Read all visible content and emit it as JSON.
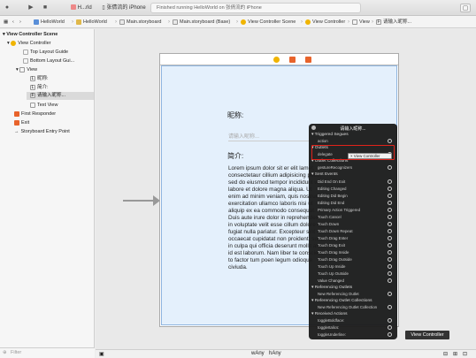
{
  "toolbar": {
    "scheme": "H...rld",
    "device": "张倩流的 iPhone",
    "status": "Finished running HelloWorld on 张倩流的 iPhone"
  },
  "jumpbar": {
    "items": [
      "HelloWorld",
      "HelloWorld",
      "Main.storyboard",
      "Main.storyboard (Base)",
      "View Controller Scene",
      "View Controller",
      "View",
      "请输入昵称..."
    ]
  },
  "outline": {
    "scene": "View Controller Scene",
    "vc": "View Controller",
    "top_guide": "Top Layout Guide",
    "bottom_guide": "Bottom Layout Gui...",
    "view": "View",
    "label_nick": "昵称:",
    "label_intro": "简介:",
    "field": "请输入昵称...",
    "textview": "Text View",
    "first_responder": "First Responder",
    "exit": "Exit",
    "entry": "Storyboard Entry Point",
    "filter_placeholder": "Filter"
  },
  "scene": {
    "nick_label": "昵称:",
    "field_placeholder": "请输入昵称...",
    "intro_label": "简介:",
    "lorem": "Lorem ipsum dolor sit er elit lamet, consectetaur cillium adipisicing pecu, sed do eiusmod tempor incididunt ut labore et dolore magna aliqua. Ut enim ad minim veniam, quis nostrud exercitation ullamco laboris nisi ut aliquip ex ea commodo consequat. Duis aute irure dolor in reprehenderit in voluptate velit esse cillum dolore eu fugiat nulla pariatur. Excepteur sint occaecat cupidatat non proident, sunt in culpa qui officia deserunt mollit anim id est laborum. Nam liber te conscient to factor tum poen legum odioque civiuda."
  },
  "hud": {
    "title": "请输入昵称...",
    "triggered_segues": "Triggered Segues",
    "action": "action",
    "outlets": "Outlets",
    "delegate": "delegate",
    "delegate_target": "View Controller",
    "outlet_collections": "Outlet Collections",
    "gesture_recognizers": "gestureRecognizers",
    "sent_events": "Sent Events",
    "events": [
      "Did End On Exit",
      "Editing Changed",
      "Editing Did Begin",
      "Editing Did End",
      "Primary Action Triggered",
      "Touch Cancel",
      "Touch Down",
      "Touch Down Repeat",
      "Touch Drag Enter",
      "Touch Drag Exit",
      "Touch Drag Inside",
      "Touch Drag Outside",
      "Touch Up Inside",
      "Touch Up Outside",
      "Value Changed"
    ],
    "referencing_outlets": "Referencing Outlets",
    "new_ref_outlet": "New Referencing Outlet",
    "referencing_outlet_collections": "Referencing Outlet Collections",
    "new_ref_outlet_collection": "New Referencing Outlet Collection",
    "received_actions": "Received Actions",
    "actions": [
      "toggleBoldface:",
      "toggleItalics:",
      "toggleUnderline:"
    ]
  },
  "tooltip": "View Controller",
  "size_class": {
    "w_prefix": "w",
    "h_prefix": "h",
    "value": "Any"
  },
  "colors": {
    "highlight": "#e0231b",
    "scene_bg": "#e4f0fc",
    "hud_bg": "#1c1c1c"
  }
}
